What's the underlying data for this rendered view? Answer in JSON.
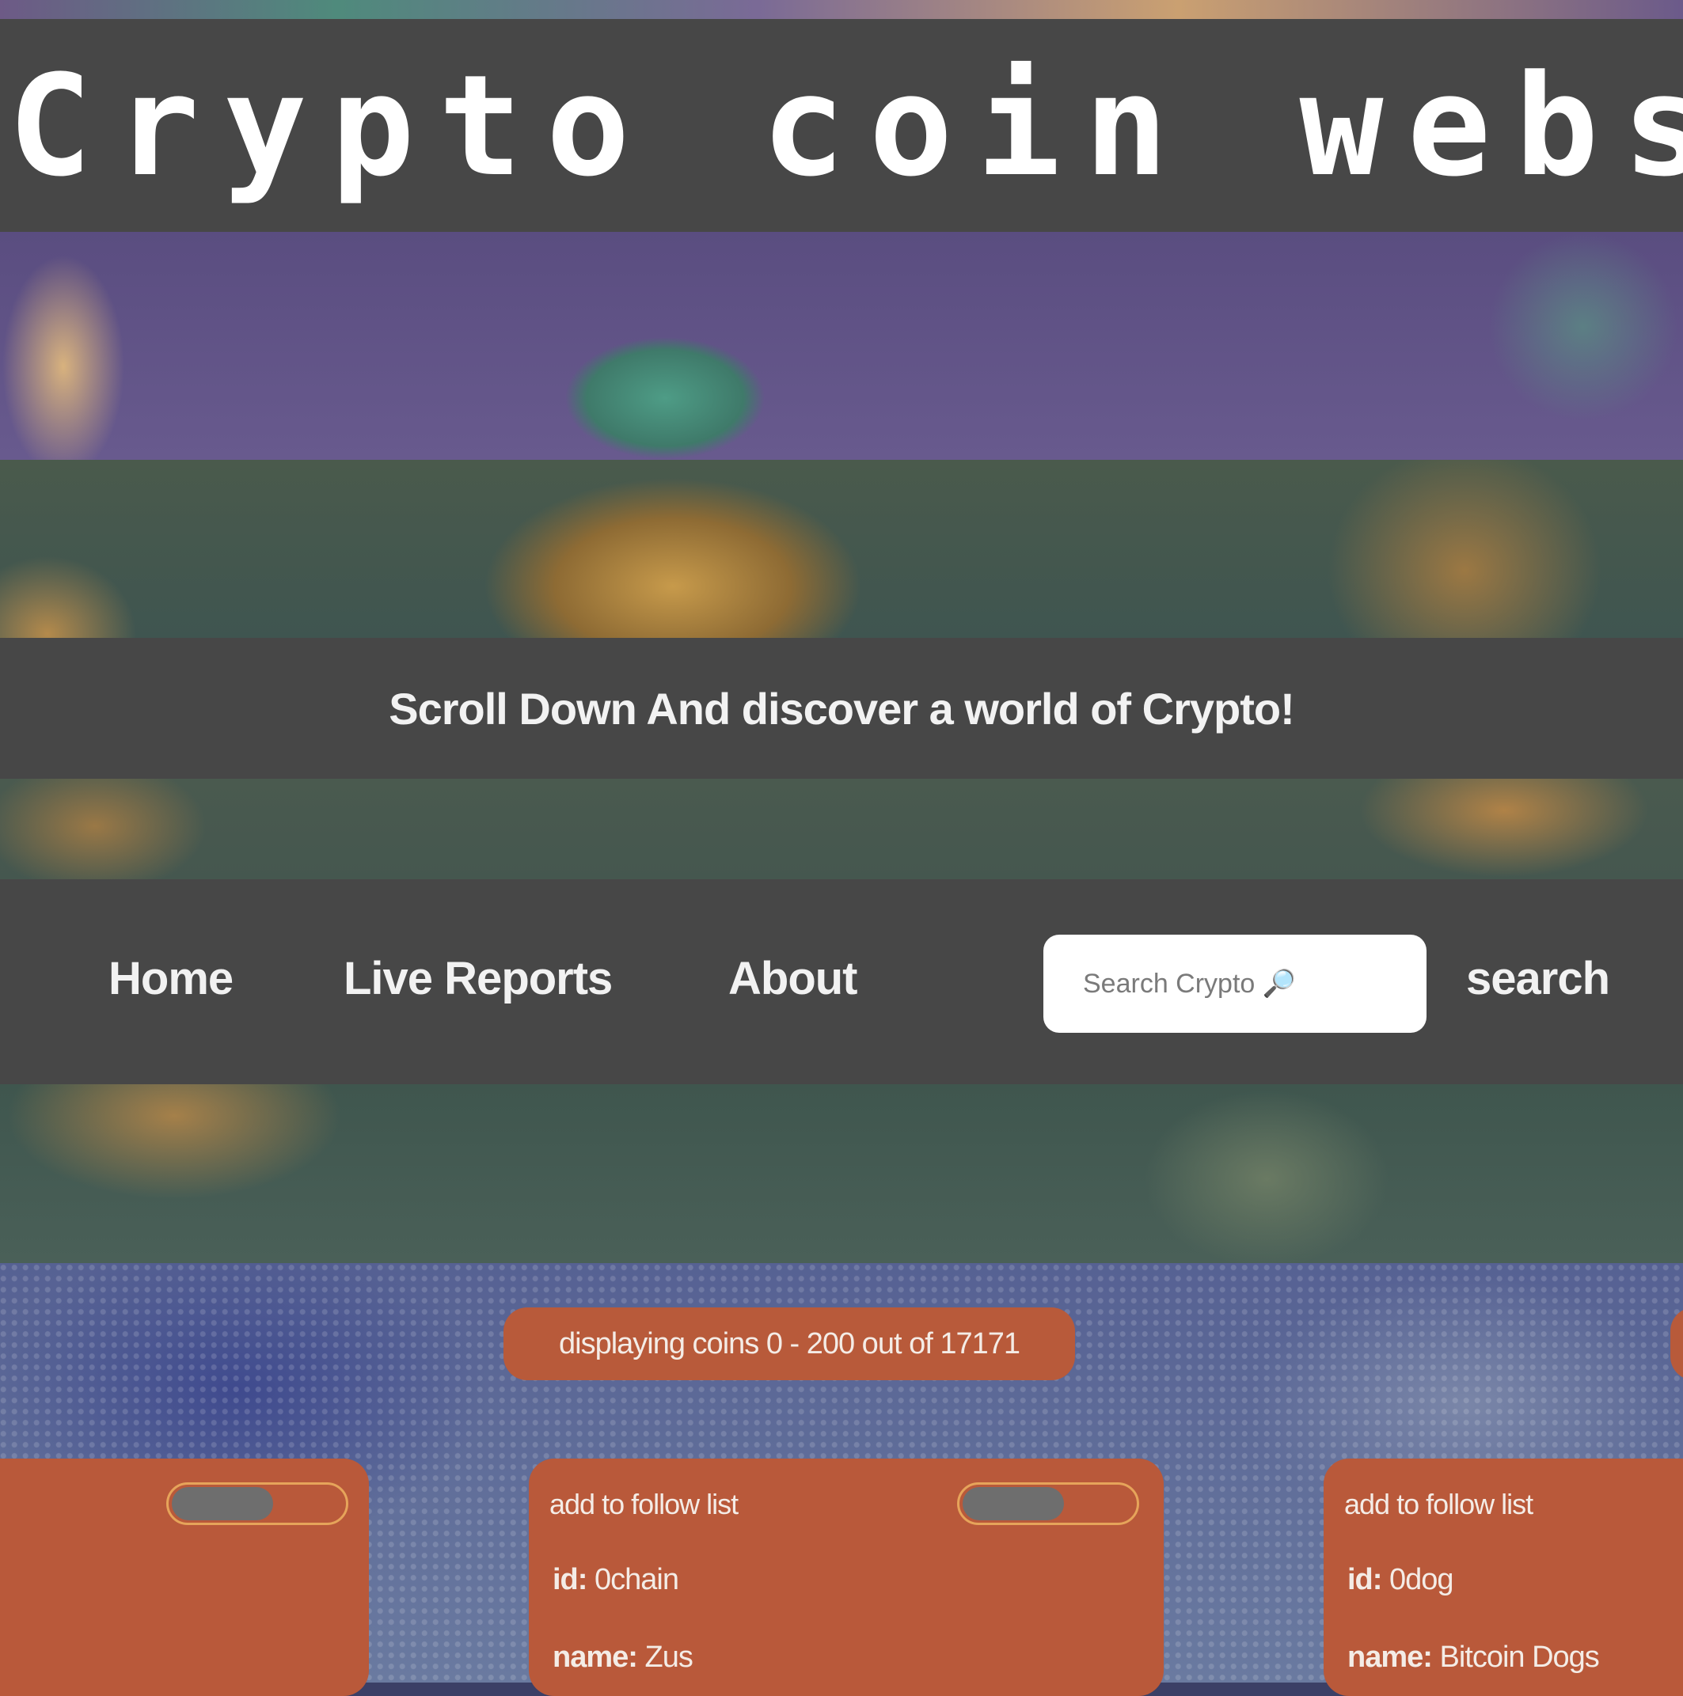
{
  "header": {
    "site_title": "Crypto coin webs",
    "tagline": "Scroll Down And discover a world of Crypto!"
  },
  "nav": {
    "home": "Home",
    "live_reports": "Live Reports",
    "about": "About"
  },
  "search": {
    "placeholder": "Search Crypto 🔎",
    "button_label": "search"
  },
  "coins": {
    "status": "displaying coins 0 - 200 out of 17171",
    "follow_label": "add to follow list",
    "id_label": "id:",
    "name_label": "name:",
    "items": [
      {
        "follow_label": "add to follow list",
        "id": "0chain",
        "name": "Zus",
        "following": false
      },
      {
        "follow_label": "add to follow list",
        "id": "0dog",
        "name": "Bitcoin Dogs",
        "following": false
      }
    ]
  },
  "colors": {
    "dark_bar": "#474747",
    "card": "#b9593a",
    "toggle_border": "#e6a45a",
    "toggle_knob": "#6e6e6e",
    "text_light": "#f2f2f2"
  },
  "icons": {
    "search": "magnifier-icon"
  }
}
